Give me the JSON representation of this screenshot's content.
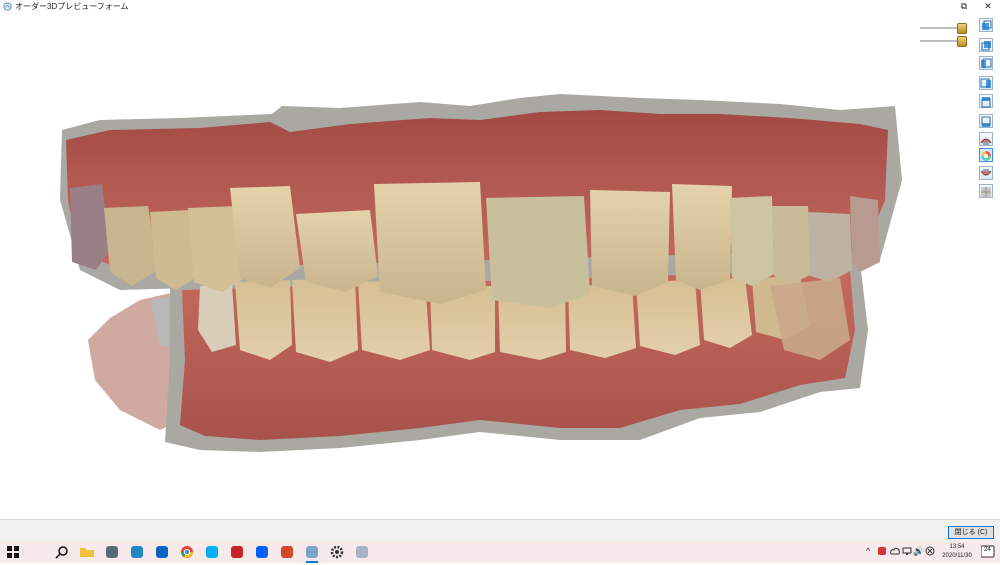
{
  "window": {
    "title": "オーダー3Dプレビューフォーム",
    "app_icon": "app-icon",
    "controls": {
      "restore_icon": "restore-icon",
      "restore_glyph": "⧉",
      "close_icon": "close-icon",
      "close_glyph": "✕"
    }
  },
  "viewer": {
    "sliders": [
      {
        "name": "upper-jaw-opacity-slider",
        "value": 0.95
      },
      {
        "name": "lower-jaw-opacity-slider",
        "value": 0.95
      }
    ],
    "tools": [
      {
        "name": "front-view-button",
        "icon": "front-view-icon"
      },
      {
        "name": "back-view-button",
        "icon": "back-view-icon"
      },
      {
        "name": "left-view-button",
        "icon": "left-view-icon"
      },
      {
        "name": "right-view-button",
        "icon": "right-view-icon"
      },
      {
        "name": "top-view-button",
        "icon": "top-view-icon"
      },
      {
        "name": "bottom-view-button",
        "icon": "bottom-view-icon"
      },
      {
        "name": "upper-jaw-button",
        "icon": "upper-jaw-icon"
      },
      {
        "name": "color-toggle-button",
        "icon": "color-wheel-icon",
        "active": true
      },
      {
        "name": "lower-jaw-button",
        "icon": "lower-jaw-icon"
      },
      {
        "name": "mesh-mode-button",
        "icon": "mesh-icon"
      }
    ],
    "gum_color": "#b9584f",
    "tooth_color": "#d9c29c",
    "base_color": "#a6a59f"
  },
  "footer": {
    "close_button_label": "閉じる (C)"
  },
  "taskbar": {
    "items": [
      {
        "name": "start-button",
        "icon": "windows-icon",
        "color": "#111111"
      },
      {
        "name": "search-button",
        "icon": "search-icon",
        "color": "#111111"
      },
      {
        "name": "file-explorer",
        "icon": "folder-icon",
        "color": "#f0c23b"
      },
      {
        "name": "taskbar-app-4",
        "icon": "monitor-app-icon",
        "color": "#5f6b7a"
      },
      {
        "name": "edge-browser",
        "icon": "edge-icon",
        "color": "#1e88c8"
      },
      {
        "name": "outlook",
        "icon": "outlook-icon",
        "color": "#0a64c4"
      },
      {
        "name": "chrome",
        "icon": "chrome-icon",
        "color": "#e94235"
      },
      {
        "name": "skype",
        "icon": "skype-icon",
        "color": "#00aff0"
      },
      {
        "name": "taskbar-app-9",
        "icon": "red-app-icon",
        "color": "#c8232b"
      },
      {
        "name": "dropbox",
        "icon": "dropbox-icon",
        "color": "#0061fe"
      },
      {
        "name": "powerpoint",
        "icon": "powerpoint-icon",
        "color": "#d24726"
      },
      {
        "name": "dental-viewer-app",
        "icon": "dental-app-icon",
        "color": "#7fa7c9",
        "active": true
      },
      {
        "name": "settings",
        "icon": "gear-icon",
        "color": "#333333"
      },
      {
        "name": "taskbar-app-14",
        "icon": "disc-app-icon",
        "color": "#a9b4c2"
      }
    ],
    "tray": {
      "chevron": "^",
      "volume_glyph": "🔊",
      "time": "13:54",
      "date": "2020/11/30",
      "notification_count": "24"
    },
    "accent": "#0078d7"
  }
}
